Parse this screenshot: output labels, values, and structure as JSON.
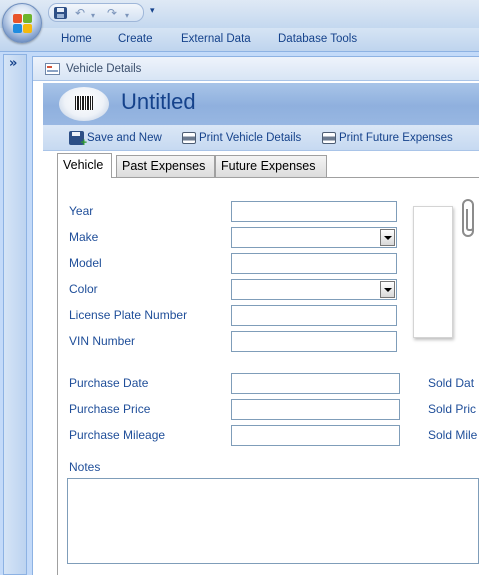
{
  "quick_access": {
    "save_icon": "save-icon",
    "undo_glyph": "↶",
    "redo_glyph": "↷",
    "dropdown_glyph": "▾",
    "customize_glyph": "▾"
  },
  "ribbon": {
    "tabs": [
      {
        "label": "Home"
      },
      {
        "label": "Create"
      },
      {
        "label": "External Data"
      },
      {
        "label": "Database Tools"
      }
    ]
  },
  "nav_pane": {
    "toggle_glyph": "»"
  },
  "document": {
    "tab_label": "Vehicle Details",
    "header_title": "Untitled"
  },
  "toolbar": {
    "save_and_new": "Save and New",
    "print_vehicle_details": "Print Vehicle Details",
    "print_future_expenses": "Print Future Expenses"
  },
  "form_tabs": [
    {
      "label": "Vehicle",
      "active": true
    },
    {
      "label": "Past Expenses",
      "active": false
    },
    {
      "label": "Future Expenses",
      "active": false
    }
  ],
  "fields": {
    "year": {
      "label": "Year",
      "value": ""
    },
    "make": {
      "label": "Make",
      "value": ""
    },
    "model": {
      "label": "Model",
      "value": ""
    },
    "color": {
      "label": "Color",
      "value": ""
    },
    "license_plate": {
      "label": "License Plate Number",
      "value": ""
    },
    "vin": {
      "label": "VIN Number",
      "value": ""
    },
    "purchase_date": {
      "label": "Purchase Date",
      "value": ""
    },
    "purchase_price": {
      "label": "Purchase Price",
      "value": ""
    },
    "purchase_mileage": {
      "label": "Purchase Mileage",
      "value": ""
    },
    "sold_date": {
      "label": "Sold Dat"
    },
    "sold_price": {
      "label": "Sold Pric"
    },
    "sold_mileage": {
      "label": "Sold Mile"
    },
    "notes": {
      "label": "Notes",
      "value": ""
    }
  },
  "colors": {
    "ribbon_text": "#15428b",
    "label_text": "#1f4e99",
    "header_gradient": "#8fb0de",
    "input_border": "#7f9db9"
  }
}
